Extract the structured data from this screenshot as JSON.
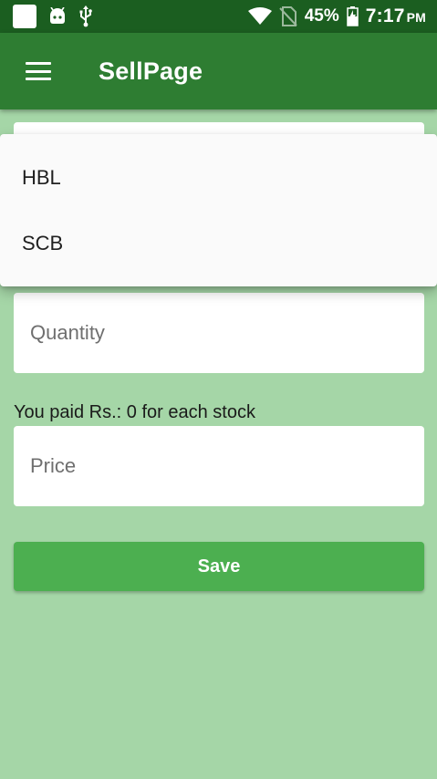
{
  "status_bar": {
    "battery": "45%",
    "time": "7:17",
    "ampm": "PM",
    "icons": [
      "square-notification-icon",
      "android-icon",
      "usb-icon",
      "wifi-icon",
      "no-sim-icon",
      "battery-charging-icon"
    ]
  },
  "app_bar": {
    "title": "SellPage"
  },
  "dropdown": {
    "items": [
      {
        "label": "HBL"
      },
      {
        "label": "SCB"
      }
    ]
  },
  "form": {
    "quantity_placeholder": "Quantity",
    "paid_text": "You paid Rs.: 0 for each stock",
    "price_placeholder": "Price",
    "save_label": "Save"
  },
  "colors": {
    "status_bar": "#1b5e20",
    "app_bar": "#2e7d32",
    "background": "#a5d6a7",
    "button": "#4caf50"
  }
}
